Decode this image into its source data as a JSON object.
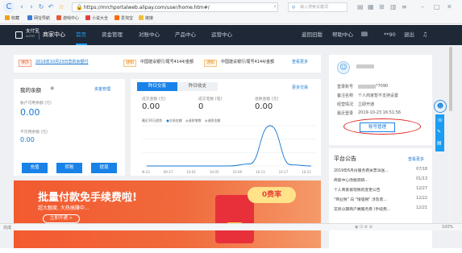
{
  "browser": {
    "url": "https://mrchportalweb.alipay.com/user/home.htm#/",
    "search_placeholder": "输入搜索关键词",
    "bookmarks": [
      {
        "label": "收藏",
        "color": "#f0a020"
      },
      {
        "label": "网址导航",
        "color": "#3a7bd5"
      },
      {
        "label": "游戏中心",
        "color": "#e25b3a"
      },
      {
        "label": "小说大全",
        "color": "#e04040"
      },
      {
        "label": "爱淘宝",
        "color": "#ff6a00"
      },
      {
        "label": "链接",
        "color": "#f0c040"
      }
    ]
  },
  "topnav": {
    "brand": "支付宝",
    "brand_sub": "ALIPAY",
    "title": "商家中心",
    "items": [
      "首页",
      "资金管理",
      "对账中心",
      "产品中心",
      "运营中心"
    ],
    "active_index": 0,
    "right": {
      "old_version": "返回旧版",
      "help": "帮助中心",
      "account": "**90",
      "logout": "退出"
    }
  },
  "notice": {
    "items": [
      {
        "tag": "待办",
        "text": "2019年10月23日您的余额付"
      },
      {
        "tag": "通知",
        "text": "中国建设银行/尾号4144/金额"
      },
      {
        "tag": "通知",
        "text": "中国建设银行/尾号4144/金额"
      }
    ],
    "more": "查看更多"
  },
  "balance": {
    "title": "我的余额",
    "manage": "资金管理",
    "available_label": "账户可用余额 (元)",
    "available_value": "0.00",
    "unavailable_label": "不可用余额 (元)",
    "unavailable_value": "0.00",
    "buttons": [
      "充值",
      "转账",
      "提现"
    ]
  },
  "trade": {
    "tabs": [
      "昨日交易",
      "昨日收支"
    ],
    "more": "更多交易",
    "stats": [
      {
        "label": "成交金额 (元)",
        "value": "0.00"
      },
      {
        "label": "成交笔数 (笔)",
        "value": "0"
      },
      {
        "label": "退款金额 (元)",
        "value": "0.00"
      }
    ],
    "legend_title": "最近30日趋势",
    "legend": [
      "交易金额",
      "退款笔数",
      "退款金额"
    ]
  },
  "chart_data": {
    "type": "line",
    "x": [
      "09-23",
      "09-27",
      "10-01",
      "10-05",
      "10-09",
      "10-13",
      "10-17",
      "10-22"
    ],
    "series": [
      {
        "name": "交易金额",
        "values": [
          0,
          0,
          0,
          0,
          0,
          0.05,
          1,
          0.03,
          0
        ]
      }
    ],
    "grid": true
  },
  "banner": {
    "title": "批量付款免手续费啦!",
    "subtitle": "超大额度, 大热搞赚中...",
    "cta": "立即开通 >",
    "badge": "0费率"
  },
  "profile": {
    "login_label": "登录账号",
    "login_value": "*7090",
    "remark_label": "备注名称",
    "remark_value": "个人商家暂不支持设置",
    "status_label": "经营情况",
    "status_value": "立即开通",
    "last_login_label": "最近登录",
    "last_login_value": "2019-10-23 16:51:56",
    "account_button": "账号管理"
  },
  "announce": {
    "title": "平台公告",
    "more": "查看更多",
    "items": [
      {
        "text": "2019年6月份服务费关票派送...",
        "date": "07/18"
      },
      {
        "text": "商家中心改版调研...",
        "date": "01/13"
      },
      {
        "text": "个人商家接现税的变更公告",
        "date": "12/27"
      },
      {
        "text": "\"商业税\" 向 \"增值税\" 涉及客...",
        "date": "12/22"
      },
      {
        "text": "花呗分期商户端服务费 (手续费...",
        "date": "12/21"
      }
    ]
  },
  "statusbar": {
    "left": "完成",
    "zoom": "100%"
  }
}
